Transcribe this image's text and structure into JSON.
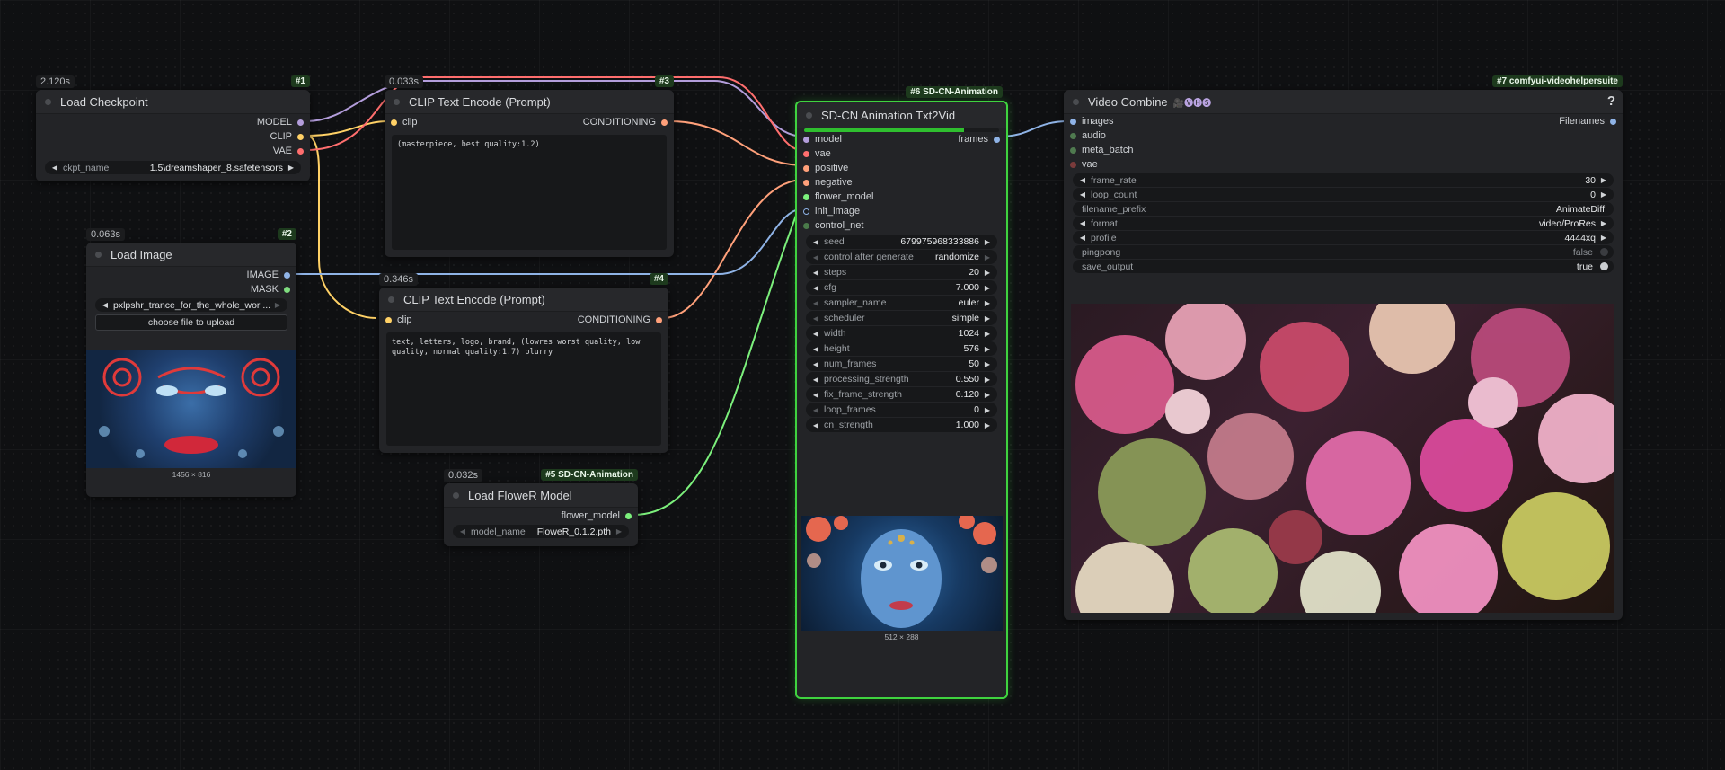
{
  "nodes": {
    "checkpoint": {
      "time": "2.120s",
      "badge": "#1",
      "title": "Load Checkpoint",
      "outputs": [
        "MODEL",
        "CLIP",
        "VAE"
      ],
      "widget": {
        "label": "ckpt_name",
        "value": "1.5\\dreamshaper_8.safetensors"
      }
    },
    "load_image": {
      "time": "0.063s",
      "badge": "#2",
      "title": "Load Image",
      "outputs": [
        "IMAGE",
        "MASK"
      ],
      "widget": {
        "value": "pxlpshr_trance_for_the_whole_wor ..."
      },
      "upload_label": "choose file to upload",
      "caption": "1456 × 816"
    },
    "clip_pos": {
      "time": "0.033s",
      "badge": "#3",
      "title": "CLIP Text Encode (Prompt)",
      "input": "clip",
      "output": "CONDITIONING",
      "text": "(masterpiece, best quality:1.2)"
    },
    "clip_neg": {
      "time": "0.346s",
      "badge": "#4",
      "title": "CLIP Text Encode (Prompt)",
      "input": "clip",
      "output": "CONDITIONING",
      "text": "text, letters, logo, brand, (lowres worst quality, low quality, normal quality:1.7) blurry"
    },
    "flower": {
      "time": "0.032s",
      "badge": "#5 SD-CN-Animation",
      "title": "Load FloweR Model",
      "output": "flower_model",
      "widget": {
        "label": "model_name",
        "value": "FloweR_0.1.2.pth"
      }
    },
    "sdcn": {
      "badge": "#6 SD-CN-Animation",
      "title": "SD-CN Animation Txt2Vid",
      "inputs": [
        "model",
        "vae",
        "positive",
        "negative",
        "flower_model",
        "init_image",
        "control_net"
      ],
      "output": "frames",
      "widgets": [
        {
          "label": "seed",
          "value": "679975968333886"
        },
        {
          "label": "control after generate",
          "value": "randomize"
        },
        {
          "label": "steps",
          "value": "20"
        },
        {
          "label": "cfg",
          "value": "7.000"
        },
        {
          "label": "sampler_name",
          "value": "euler"
        },
        {
          "label": "scheduler",
          "value": "simple"
        },
        {
          "label": "width",
          "value": "1024"
        },
        {
          "label": "height",
          "value": "576"
        },
        {
          "label": "num_frames",
          "value": "50"
        },
        {
          "label": "processing_strength",
          "value": "0.550"
        },
        {
          "label": "fix_frame_strength",
          "value": "0.120"
        },
        {
          "label": "loop_frames",
          "value": "0"
        },
        {
          "label": "cn_strength",
          "value": "1.000"
        }
      ],
      "caption": "512 × 288"
    },
    "video": {
      "badge": "#7 comfyui-videohelpersuite",
      "title": "Video Combine",
      "title_icons": "🎥🅥🅗🅢",
      "help": "?",
      "inputs": [
        "images",
        "audio",
        "meta_batch",
        "vae"
      ],
      "output": "Filenames",
      "widgets": [
        {
          "label": "frame_rate",
          "value": "30"
        },
        {
          "label": "loop_count",
          "value": "0"
        },
        {
          "label": "filename_prefix",
          "value": "AnimateDiff"
        },
        {
          "label": "format",
          "value": "video/ProRes"
        },
        {
          "label": "profile",
          "value": "4444xq"
        },
        {
          "label": "pingpong",
          "value": "false"
        },
        {
          "label": "save_output",
          "value": "true"
        }
      ]
    }
  },
  "colors": {
    "model": "#b39ddb",
    "clip": "#ffd166",
    "vae": "#ff6e6e",
    "conditioning": "#ffa07a",
    "image": "#8fb3e6",
    "mask": "#7fdc7f",
    "flower": "#7cf07c",
    "generic": "#6b8f6b",
    "selected": "#3fd33f"
  }
}
